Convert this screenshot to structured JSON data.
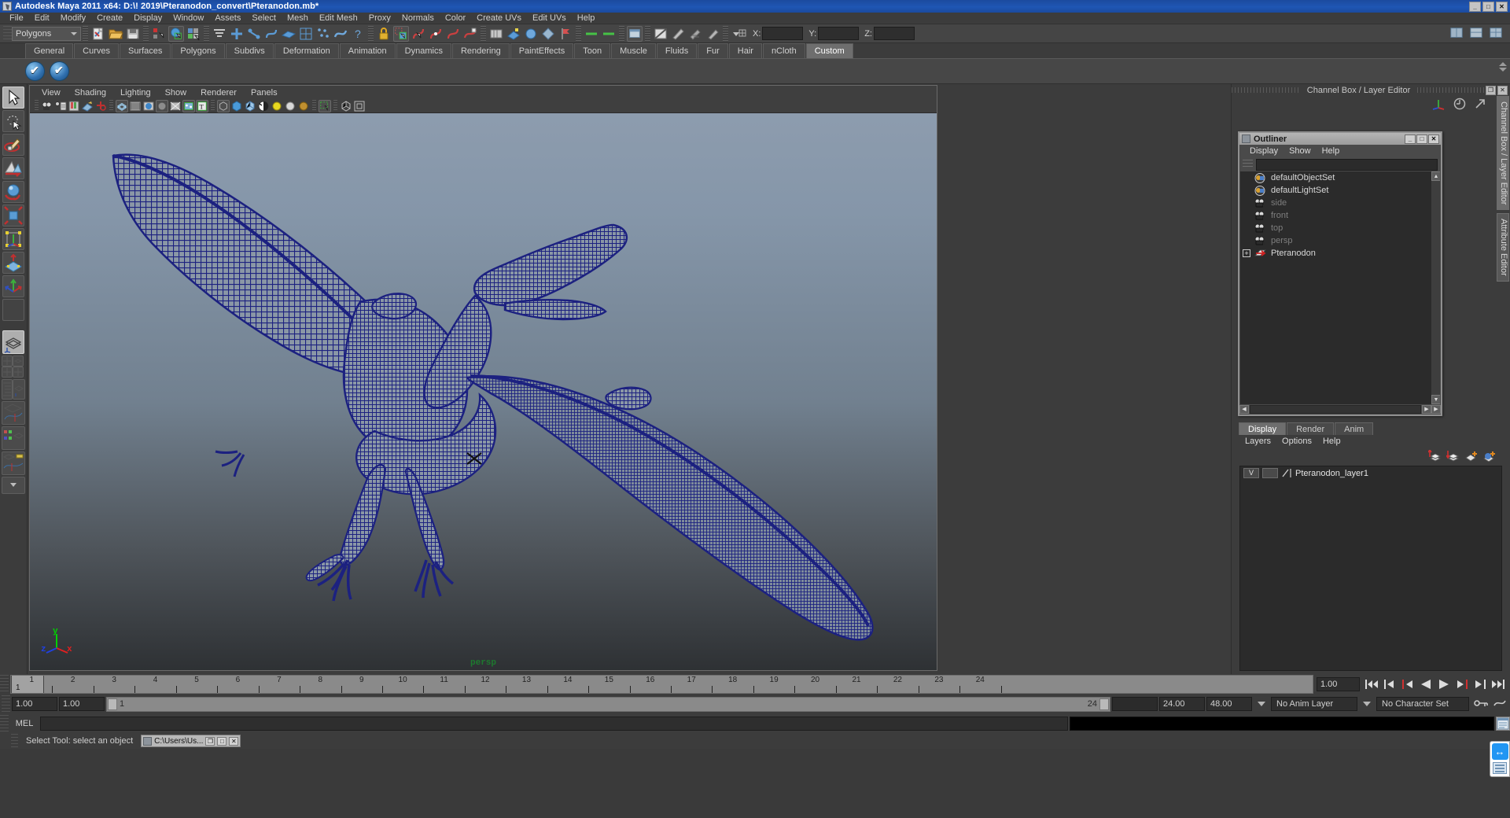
{
  "window": {
    "title": "Autodesk Maya 2011 x64: D:\\! 2019\\Pteranodon_convert\\Pteranodon.mb*",
    "buttons": [
      "_",
      "□",
      "✕"
    ]
  },
  "menubar": {
    "items": [
      "File",
      "Edit",
      "Modify",
      "Create",
      "Display",
      "Window",
      "Assets",
      "Select",
      "Mesh",
      "Edit Mesh",
      "Proxy",
      "Normals",
      "Color",
      "Create UVs",
      "Edit UVs",
      "Help"
    ]
  },
  "statusline": {
    "menuset": "Polygons",
    "x_label": "X:",
    "y_label": "Y:",
    "z_label": "Z:",
    "x_value": "",
    "y_value": "",
    "z_value": ""
  },
  "shelf": {
    "tabs": [
      "General",
      "Curves",
      "Surfaces",
      "Polygons",
      "Subdivs",
      "Deformation",
      "Animation",
      "Dynamics",
      "Rendering",
      "PaintEffects",
      "Toon",
      "Muscle",
      "Fluids",
      "Fur",
      "Hair",
      "nCloth",
      "Custom"
    ],
    "active_tab": "Custom",
    "item_count": 2
  },
  "toolbox": {
    "tools": [
      {
        "name": "select-tool",
        "active": true
      },
      {
        "name": "lasso-select-tool",
        "active": false
      },
      {
        "name": "paint-select-tool",
        "active": false
      },
      {
        "name": "move-tool",
        "active": false
      },
      {
        "name": "rotate-tool",
        "active": false
      },
      {
        "name": "scale-tool",
        "active": false
      },
      {
        "name": "universal-manipulator-tool",
        "active": false
      },
      {
        "name": "soft-modification-tool",
        "active": false
      },
      {
        "name": "last-tool-used",
        "active": false
      },
      {
        "name": "blank-slot",
        "active": false
      }
    ],
    "layouts": [
      "single-perspective-view",
      "four-view",
      "two-pane-side-by-side",
      "two-pane-stacked",
      "outliner-persp",
      "persp-graph",
      "hypershade-persp",
      "persp-graph-editor"
    ]
  },
  "viewport": {
    "menus": [
      "View",
      "Shading",
      "Lighting",
      "Show",
      "Renderer",
      "Panels"
    ],
    "camera_label": "persp",
    "axis": {
      "x": "x",
      "y": "y",
      "z": "z"
    },
    "wireframe_color": "#1c2180",
    "background_top": "#8d9cae",
    "background_bottom": "#2e3134",
    "model": "Pteranodon wireframe mesh"
  },
  "right_dock": {
    "title": "Channel Box / Layer Editor",
    "title_buttons": [
      "❐",
      "✕"
    ],
    "vertical_tabs": [
      {
        "label": "Channel Box / Layer Editor",
        "active": true
      },
      {
        "label": "Attribute Editor",
        "active": false
      }
    ]
  },
  "outliner": {
    "title": "Outliner",
    "window_buttons": [
      "_",
      "□",
      "✕"
    ],
    "menus": [
      "Display",
      "Show",
      "Help"
    ],
    "search_value": "",
    "search_placeholder": "",
    "items": [
      {
        "label": "Pteranodon",
        "icon": "transform-icon",
        "dim": false,
        "expandable": true
      },
      {
        "label": "persp",
        "icon": "camera-icon",
        "dim": true,
        "expandable": false
      },
      {
        "label": "top",
        "icon": "camera-icon",
        "dim": true,
        "expandable": false
      },
      {
        "label": "front",
        "icon": "camera-icon",
        "dim": true,
        "expandable": false
      },
      {
        "label": "side",
        "icon": "camera-icon",
        "dim": true,
        "expandable": false
      },
      {
        "label": "defaultLightSet",
        "icon": "set-icon",
        "dim": false,
        "expandable": false
      },
      {
        "label": "defaultObjectSet",
        "icon": "set-icon",
        "dim": false,
        "expandable": false
      }
    ]
  },
  "layer_editor": {
    "tabs": [
      "Display",
      "Render",
      "Anim"
    ],
    "active_tab": "Display",
    "menus": [
      "Layers",
      "Options",
      "Help"
    ],
    "toolbar_icons": [
      "move-layer-up-icon",
      "move-layer-down-icon",
      "new-layer-icon",
      "new-layer-from-selected-icon"
    ],
    "layers": [
      {
        "visibility": "V",
        "playback": "",
        "name": "Pteranodon_layer1"
      }
    ]
  },
  "timeline": {
    "ticks": [
      "1",
      "2",
      "3",
      "4",
      "5",
      "6",
      "7",
      "8",
      "9",
      "10",
      "11",
      "12",
      "13",
      "14",
      "15",
      "16",
      "17",
      "18",
      "19",
      "20",
      "21",
      "22",
      "23",
      "24"
    ],
    "current_frame": "1",
    "current_frame_field": "1.00",
    "playback_buttons": [
      "go-to-start",
      "step-back-keyframe",
      "step-back-frame",
      "play-backwards",
      "play-forwards",
      "step-forward-frame",
      "step-forward-keyframe",
      "go-to-end"
    ]
  },
  "range_slider": {
    "anim_start": "1.00",
    "range_start": "1.00",
    "slider_start_label": "1",
    "slider_end_label": "24",
    "range_end": "24.00",
    "anim_end": "48.00",
    "anim_layer": "No Anim Layer",
    "character_set": "No Character Set"
  },
  "command_line": {
    "label": "MEL",
    "input_value": "",
    "output_value": ""
  },
  "help_line": {
    "text": "Select Tool: select an object",
    "taskbar_item": "C:\\Users\\Us...",
    "taskbar_buttons": [
      "❐",
      "□",
      "✕"
    ]
  }
}
